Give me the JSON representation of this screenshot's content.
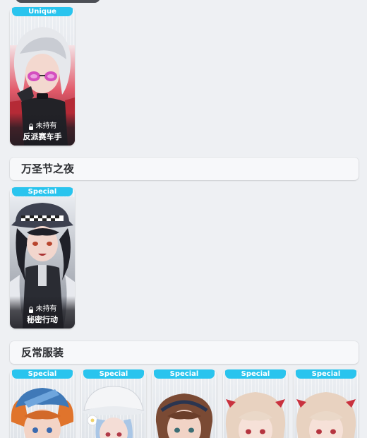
{
  "sections": [
    {
      "title": "",
      "cards": [
        {
          "badge": "Unique",
          "status": "未持有",
          "name": "反派赛车手"
        }
      ]
    },
    {
      "title": "万圣节之夜",
      "cards": [
        {
          "badge": "Special",
          "status": "未持有",
          "name": "秘密行动"
        }
      ]
    },
    {
      "title": "反常服装",
      "cards": [
        {
          "badge": "Special"
        },
        {
          "badge": "Special"
        },
        {
          "badge": "Special"
        },
        {
          "badge": "Special"
        },
        {
          "badge": "Special"
        }
      ]
    }
  ],
  "colors": {
    "badge_bg": "#29c4ee",
    "page_bg": "#eef0f3",
    "section_bg": "#f7f8fa"
  },
  "icons": {
    "lock": "lock-icon"
  }
}
